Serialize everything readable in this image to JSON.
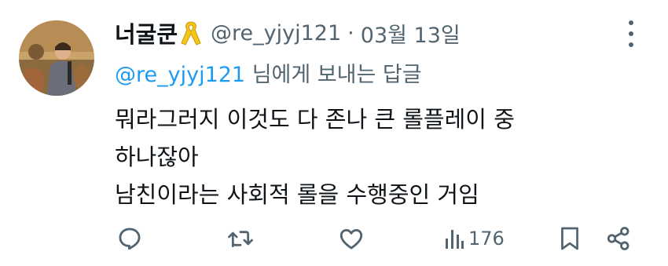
{
  "tweet": {
    "display_name": "너굴쿤",
    "handle": "@re_yjyj121",
    "separator": "·",
    "date": "03월 13일",
    "reply_to_mention": "@re_yjyj121",
    "reply_to_suffix": " 님에게 보내는 답글",
    "text_lines": [
      "뭐라그러지 이것도 다 존나 큰 롤플레이 중",
      "하나잖아",
      "남친이라는 사회적 롤을 수행중인 거임"
    ],
    "views_count": "176"
  },
  "icons": {
    "avatar": "avatar-image",
    "badge": "yellow-ribbon-icon",
    "more": "more-options-icon",
    "reply": "reply-icon",
    "retweet": "retweet-icon",
    "like": "like-icon",
    "views": "views-icon",
    "bookmark": "bookmark-icon",
    "share": "share-icon"
  },
  "colors": {
    "text": "#0f1419",
    "secondary": "#536471",
    "link": "#1d9bf0",
    "ribbon": "#f5c518"
  }
}
